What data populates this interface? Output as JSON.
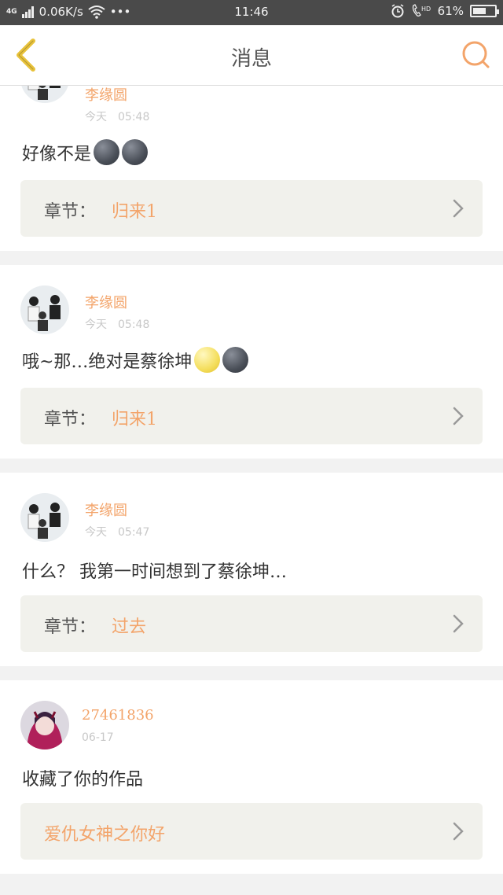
{
  "status_bar": {
    "network": "4G",
    "speed": "0.06K/s",
    "dots": "•••",
    "time": "11:46",
    "battery": "61%",
    "battery_level": 0.61
  },
  "header": {
    "title": "消息"
  },
  "messages": [
    {
      "username": "李缘圆",
      "date_label": "今天",
      "time": "05:48",
      "text": "好像不是",
      "emojis": [
        "dark-moon",
        "dark-moon"
      ],
      "chapter_label": "章节：",
      "chapter_value": "归来1"
    },
    {
      "username": "李缘圆",
      "date_label": "今天",
      "time": "05:48",
      "text": "哦~那…绝对是蔡徐坤",
      "emojis": [
        "yellow-moon",
        "dark-moon"
      ],
      "chapter_label": "章节：",
      "chapter_value": "归来1"
    },
    {
      "username": "李缘圆",
      "date_label": "今天",
      "time": "05:47",
      "text": "什么？ 我第一时间想到了蔡徐坤…",
      "emojis": [],
      "chapter_label": "章节：",
      "chapter_value": "过去"
    },
    {
      "username": "27461836",
      "date_label": "06-17",
      "time": "",
      "text": "收藏了你的作品",
      "emojis": [],
      "chapter_label": "",
      "chapter_value": "爱仇女神之你好"
    }
  ],
  "colors": {
    "accent": "#f3a46a",
    "back_arrow": "#e8c23a",
    "chip_bg": "#f1f1ec"
  }
}
